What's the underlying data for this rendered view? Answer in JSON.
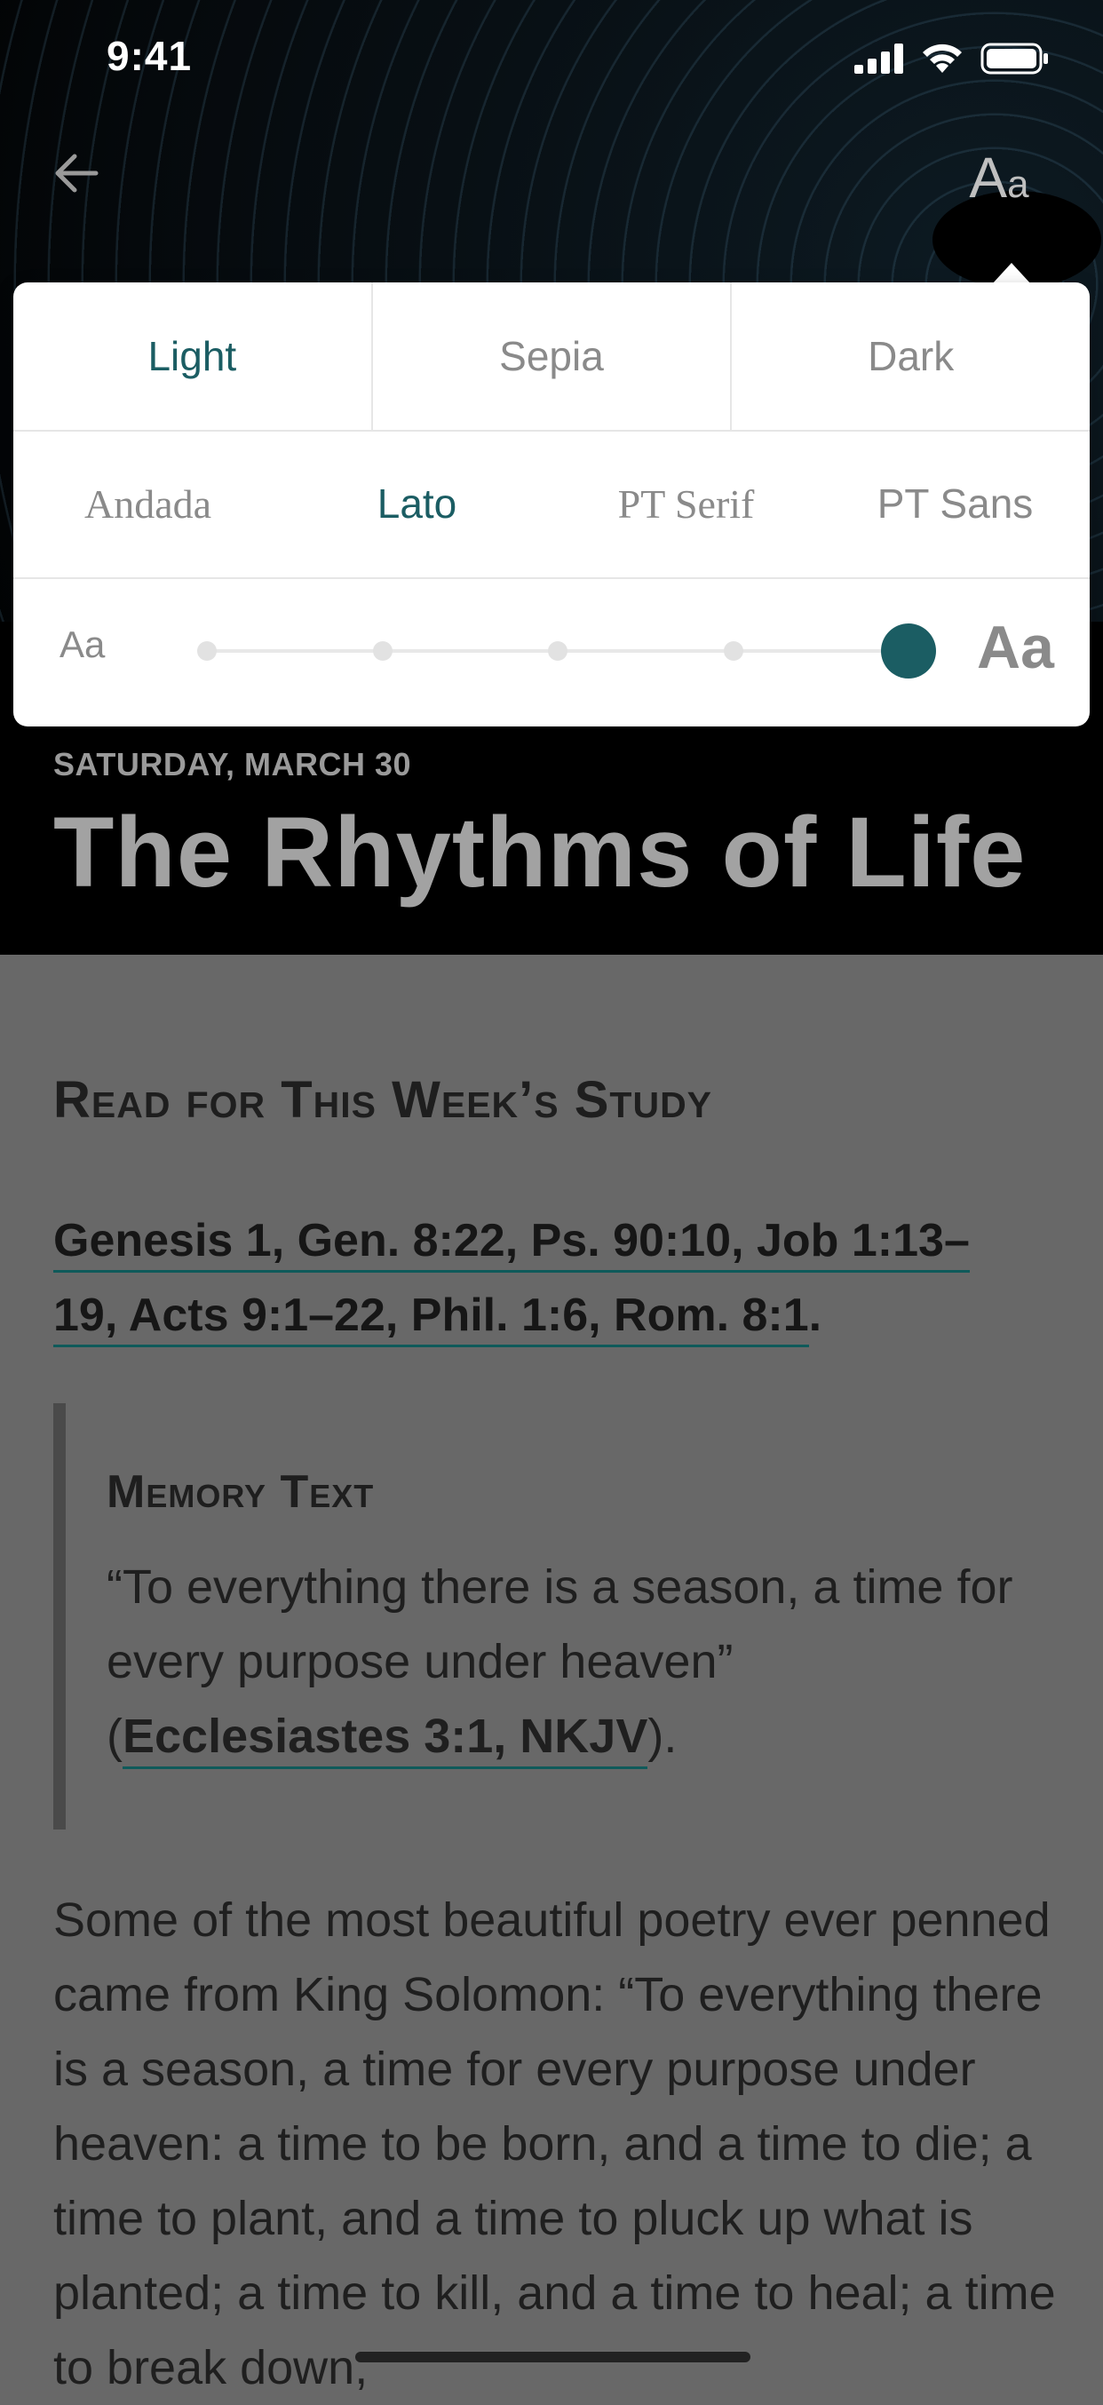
{
  "status_bar": {
    "time": "9:41"
  },
  "header": {
    "font_button_label_big": "A",
    "font_button_label_small": "a"
  },
  "appearance_popover": {
    "themes": [
      {
        "label": "Light",
        "active": true
      },
      {
        "label": "Sepia",
        "active": false
      },
      {
        "label": "Dark",
        "active": false
      }
    ],
    "fonts": [
      {
        "label": "Andada",
        "active": false
      },
      {
        "label": "Lato",
        "active": true
      },
      {
        "label": "PT Serif",
        "active": false
      },
      {
        "label": "PT Sans",
        "active": false
      }
    ],
    "size": {
      "small_label": "Aa",
      "large_label": "Aa",
      "steps": 5,
      "selected_step": 5
    },
    "accent_color": "#1b5d63"
  },
  "lesson": {
    "date": "SATURDAY, MARCH 30",
    "title": "The Rhythms of Life",
    "section_heading": "Read for This Week’s Study",
    "references": {
      "line1": "Genesis 1, Gen. 8:22, Ps. 90:10, Job 1:13–",
      "line2": "19, Acts 9:1–22, Phil. 1:6, Rom. 8:1",
      "trailing": "."
    },
    "memory_text": {
      "title": "Memory Text",
      "quote": "“To everything there is a season, a time for every purpose under heaven”",
      "open_paren": "(",
      "reference": "Ecclesiastes 3:1, NKJV",
      "close_paren": ")."
    },
    "body": "Some of the most beautiful poetry ever penned came from King Solomon: “To everything there is a season, a time for every purpose under heaven: a time to be born, and a time to die; a time to plant, and a time to pluck up what is planted; a time to kill, and a time to heal; a time to break down,"
  }
}
